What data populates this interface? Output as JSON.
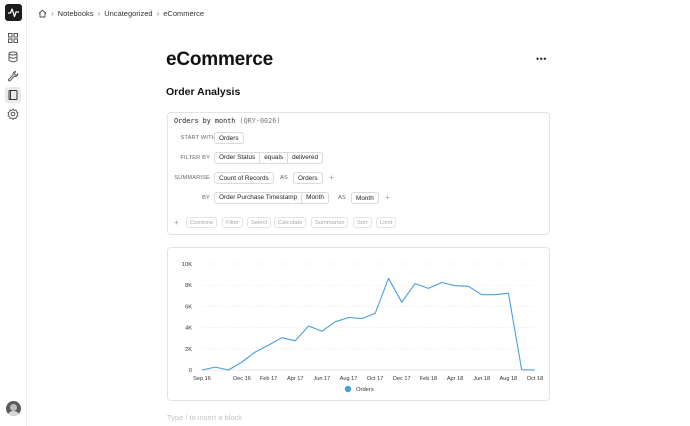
{
  "breadcrumb": {
    "items": [
      "Notebooks",
      "Uncategorized",
      "eCommerce"
    ]
  },
  "page": {
    "title": "eCommerce",
    "more_label": "•••"
  },
  "section": {
    "title": "Order Analysis"
  },
  "query": {
    "name": "Orders by month",
    "id": "(QRY-0026)",
    "start_with_label": "START WITH",
    "start_with_value": "Orders",
    "filter_by_label": "FILTER BY",
    "filter": [
      "Order Status",
      "equals",
      "delivered"
    ],
    "summarise_label": "SUMMARISE",
    "summarise_value": "Count of Records",
    "as_label": "AS",
    "summarise_alias": "Orders",
    "by_label": "BY",
    "by_field": [
      "Order Purchase Timestamp",
      "Month"
    ],
    "by_alias": "Month",
    "plus_symbol": "+",
    "operations": [
      "Combine",
      "Filter",
      "Select",
      "Calculate",
      "Summarise",
      "Sort",
      "Limit"
    ]
  },
  "placeholder": "Type / to insert a block",
  "colors": {
    "line": "#4a9fd8",
    "grid": "#e6e6e6",
    "accent_dark": "#1c1c1e"
  },
  "chart_data": {
    "type": "line",
    "x": [
      "Sep 16",
      "Oct 16",
      "Nov 16",
      "Dec 16",
      "Jan 17",
      "Feb 17",
      "Mar 17",
      "Apr 17",
      "May 17",
      "Jun 17",
      "Jul 17",
      "Aug 17",
      "Sep 17",
      "Oct 17",
      "Nov 17",
      "Dec 17",
      "Jan 18",
      "Feb 18",
      "Mar 18",
      "Apr 18",
      "May 18",
      "Jun 18",
      "Jul 18",
      "Aug 18",
      "Sep 18",
      "Oct 18"
    ],
    "x_tick_labels": [
      "Sep 16",
      "Dec 16",
      "Feb 17",
      "Apr 17",
      "Jun 17",
      "Aug 17",
      "Oct 17",
      "Dec 17",
      "Feb 18",
      "Apr 18",
      "Jun 18",
      "Aug 18",
      "Oct 18"
    ],
    "x_tick_indices": [
      0,
      3,
      5,
      7,
      9,
      11,
      13,
      15,
      17,
      19,
      21,
      23,
      25
    ],
    "series": [
      {
        "name": "Orders",
        "values": [
          1,
          270,
          0,
          750,
          1700,
          2350,
          3050,
          2750,
          4150,
          3650,
          4550,
          4950,
          4850,
          5350,
          8650,
          6400,
          8150,
          7700,
          8250,
          7950,
          7900,
          7100,
          7100,
          7250,
          16,
          4
        ]
      }
    ],
    "ylim": [
      0,
      10000
    ],
    "y_ticks": [
      "0",
      "2K",
      "4K",
      "6K",
      "8K",
      "10K"
    ],
    "y_tick_values": [
      0,
      2000,
      4000,
      6000,
      8000,
      10000
    ],
    "grid": true,
    "legend_position": "bottom"
  }
}
